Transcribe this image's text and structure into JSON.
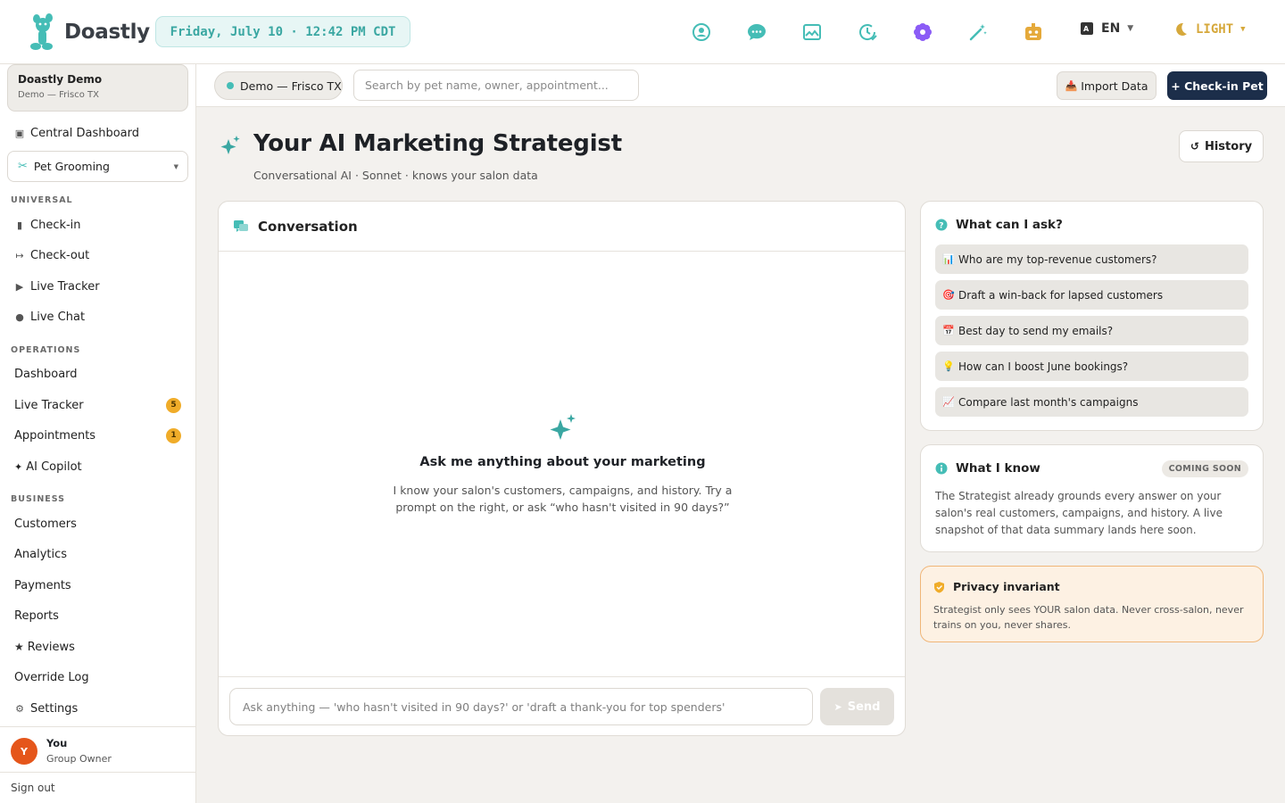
{
  "app": {
    "name": "Doastly"
  },
  "header": {
    "datetime": "Friday, July 10 · 12:42 PM CDT",
    "icons": [
      "profile-icon",
      "chat-icon",
      "image-icon",
      "schedule-icon",
      "flower-icon",
      "magic-wand-icon",
      "robot-icon"
    ],
    "language": "EN",
    "theme": "LIGHT"
  },
  "sidebar": {
    "org": {
      "name": "Doastly Demo",
      "sub": "Demo — Frisco TX"
    },
    "central": "Central Dashboard",
    "vertical": "Pet Grooming",
    "sections": {
      "universal": "UNIVERSAL",
      "operations": "OPERATIONS",
      "business": "BUSINESS"
    },
    "universal": [
      {
        "label": "Check-in"
      },
      {
        "label": "Check-out"
      },
      {
        "label": "Live Tracker"
      },
      {
        "label": "Live Chat"
      }
    ],
    "operations": [
      {
        "label": "Dashboard",
        "badge": ""
      },
      {
        "label": "Live Tracker",
        "badge": "5"
      },
      {
        "label": "Appointments",
        "badge": "1"
      },
      {
        "label": "AI Copilot",
        "badge": ""
      }
    ],
    "business": [
      {
        "label": "Customers"
      },
      {
        "label": "Analytics"
      },
      {
        "label": "Payments"
      },
      {
        "label": "Reports"
      },
      {
        "label": "Reviews"
      },
      {
        "label": "Override Log"
      },
      {
        "label": "Settings"
      }
    ],
    "user": {
      "initial": "Y",
      "name": "You",
      "role": "Group Owner"
    },
    "signout": "Sign out"
  },
  "subbar": {
    "location": "Demo — Frisco TX",
    "search_placeholder": "Search by pet name, owner, appointment...",
    "import": "Import Data",
    "checkin": "+ Check-in Pet"
  },
  "page": {
    "title": "Your AI Marketing Strategist",
    "subtitle": "Conversational AI · Sonnet · knows your salon data",
    "history": "History"
  },
  "conversation": {
    "title": "Conversation",
    "empty_title": "Ask me anything about your marketing",
    "empty_desc": "I know your salon's customers, campaigns, and history. Try a prompt on the right, or ask “who hasn't visited in 90 days?”",
    "input_placeholder": "Ask anything — 'who hasn't visited in 90 days?' or 'draft a thank-you for top spenders'",
    "send": "Send"
  },
  "suggestions": {
    "title": "What can I ask?",
    "items": [
      {
        "emoji": "📊",
        "label": "Who are my top-revenue customers?"
      },
      {
        "emoji": "🎯",
        "label": "Draft a win-back for lapsed customers"
      },
      {
        "emoji": "📅",
        "label": "Best day to send my emails?"
      },
      {
        "emoji": "💡",
        "label": "How can I boost June bookings?"
      },
      {
        "emoji": "📈",
        "label": "Compare last month's campaigns"
      }
    ]
  },
  "knowledge": {
    "title": "What I know",
    "badge": "COMING SOON",
    "text": "The Strategist already grounds every answer on your salon's real customers, campaigns, and history. A live snapshot of that data summary lands here soon."
  },
  "privacy": {
    "title": "Privacy invariant",
    "text": "Strategist only sees YOUR salon data. Never cross-salon, never trains on you, never shares."
  },
  "colors": {
    "accent": "#45bdb6",
    "navy": "#1c2e4a",
    "badge": "#f0ac29",
    "avatar": "#e5561b"
  }
}
